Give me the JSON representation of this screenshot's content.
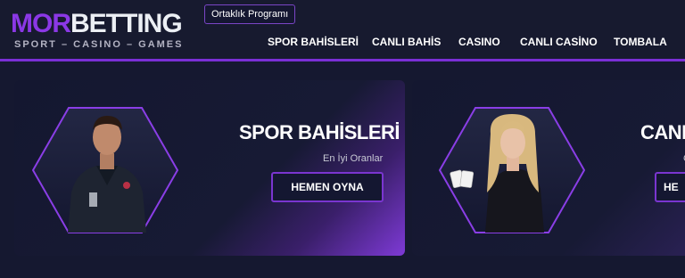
{
  "brand": {
    "name_part1": "MOR",
    "name_part2": "BETTING",
    "tagline": "SPORT – CASINO – GAMES"
  },
  "header": {
    "affiliate_label": "Ortaklık Programı"
  },
  "nav": {
    "items": [
      {
        "label": "SPOR BAHİSLERİ"
      },
      {
        "label": "CANLI BAHİS"
      },
      {
        "label": "CASINO"
      },
      {
        "label": "CANLI CASİNO"
      },
      {
        "label": "TOMBALA"
      }
    ]
  },
  "cards": [
    {
      "title": "SPOR BAHİSLERİ",
      "subtitle": "En İyi Oranlar",
      "button": "HEMEN OYNA"
    },
    {
      "title": "CANLI",
      "subtitle": "C",
      "button": "HE"
    }
  ],
  "colors": {
    "accent": "#7a2fd6",
    "background": "#171a30",
    "text": "#ffffff"
  }
}
